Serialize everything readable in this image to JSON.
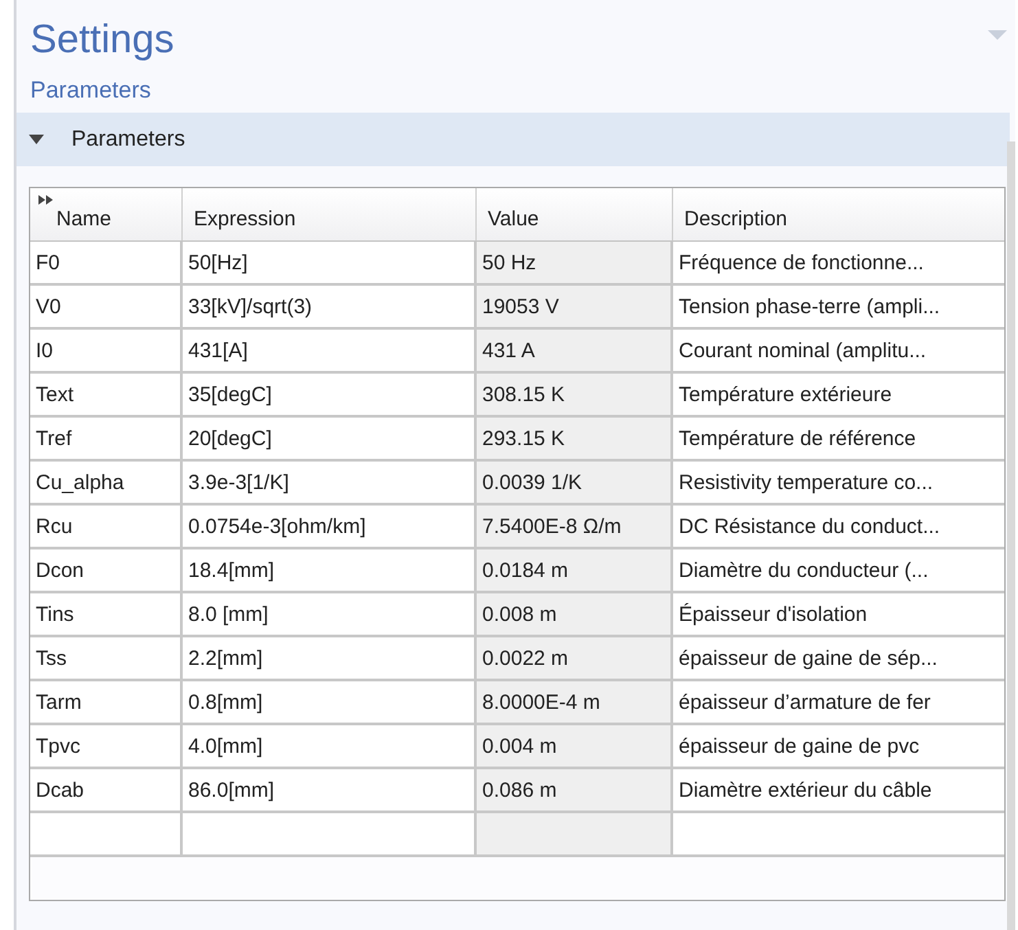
{
  "title": "Settings",
  "subtitle": "Parameters",
  "section": {
    "label": "Parameters",
    "expanded": true
  },
  "table": {
    "columns": [
      "Name",
      "Expression",
      "Value",
      "Description"
    ],
    "rows": [
      {
        "name": "F0",
        "expression": "50[Hz]",
        "value": "50 Hz",
        "description": "Fréquence de fonctionne..."
      },
      {
        "name": "V0",
        "expression": "33[kV]/sqrt(3)",
        "value": "19053 V",
        "description": "Tension phase-terre (ampli..."
      },
      {
        "name": "I0",
        "expression": "431[A]",
        "value": "431 A",
        "description": "Courant nominal (amplitu..."
      },
      {
        "name": "Text",
        "expression": "35[degC]",
        "value": "308.15 K",
        "description": "Température extérieure"
      },
      {
        "name": "Tref",
        "expression": "20[degC]",
        "value": "293.15 K",
        "description": "Température de référence"
      },
      {
        "name": "Cu_alpha",
        "expression": "3.9e-3[1/K]",
        "value": "0.0039 1/K",
        "description": "Resistivity temperature co..."
      },
      {
        "name": "Rcu",
        "expression": "0.0754e-3[ohm/km]",
        "value": "7.5400E-8 Ω/m",
        "description": "DC Résistance du conduct..."
      },
      {
        "name": "Dcon",
        "expression": "18.4[mm]",
        "value": "0.0184 m",
        "description": "Diamètre du conducteur (..."
      },
      {
        "name": "Tins",
        "expression": "8.0 [mm]",
        "value": "0.008 m",
        "description": "Épaisseur d'isolation"
      },
      {
        "name": "Tss",
        "expression": "2.2[mm]",
        "value": "0.0022 m",
        "description": "épaisseur de gaine de sép..."
      },
      {
        "name": "Tarm",
        "expression": "0.8[mm]",
        "value": "8.0000E-4 m",
        "description": "épaisseur d’armature de fer"
      },
      {
        "name": "Tpvc",
        "expression": "4.0[mm]",
        "value": "0.004 m",
        "description": "épaisseur de gaine de pvc"
      },
      {
        "name": "Dcab",
        "expression": "86.0[mm]",
        "value": "0.086 m",
        "description": "Diamètre extérieur du câble"
      }
    ]
  }
}
